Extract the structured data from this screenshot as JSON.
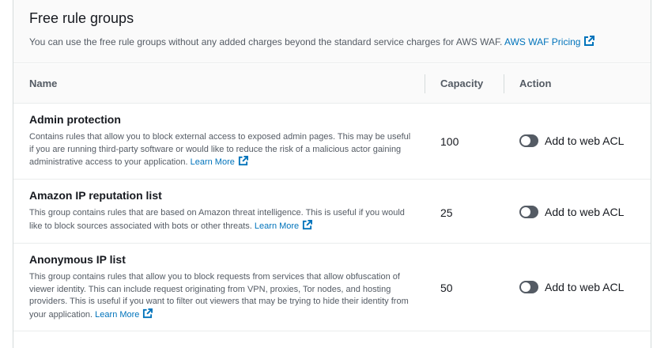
{
  "section": {
    "title": "Free rule groups",
    "description": "You can use the free rule groups without any added charges beyond the standard service charges for AWS WAF.",
    "pricing_link": "AWS WAF Pricing",
    "external_icon": "external-link-icon"
  },
  "table": {
    "columns": [
      "Name",
      "Capacity",
      "Action"
    ],
    "rows": [
      {
        "name": "Admin protection",
        "description": "Contains rules that allow you to block external access to exposed admin pages. This may be useful if you are running third-party software or would like to reduce the risk of a malicious actor gaining administrative access to your application.",
        "learn_more": "Learn More",
        "capacity": "100",
        "action": "Add to web ACL"
      },
      {
        "name": "Amazon IP reputation list",
        "description": "This group contains rules that are based on Amazon threat intelligence. This is useful if you would like to block sources associated with bots or other threats.",
        "learn_more": "Learn More",
        "capacity": "25",
        "action": "Add to web ACL"
      },
      {
        "name": "Anonymous IP list",
        "description": "This group contains rules that allow you to block requests from services that allow obfuscation of viewer identity. This can include request originating from VPN, proxies, Tor nodes, and hosting providers. This is useful if you want to filter out viewers that may be trying to hide their identity from your application.",
        "learn_more": "Learn More",
        "capacity": "50",
        "action": "Add to web ACL"
      }
    ]
  },
  "colors": {
    "link": "#0073bb",
    "toggle_off": "#545b64",
    "border": "#d5dbdb"
  }
}
